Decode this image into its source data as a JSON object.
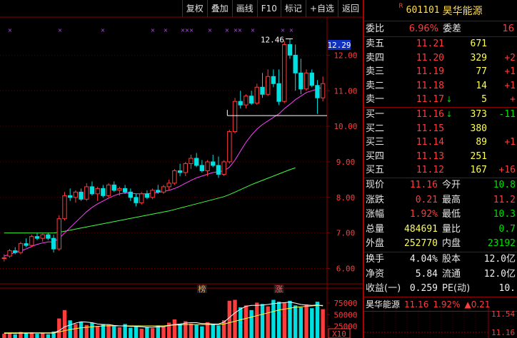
{
  "toolbar": {
    "items": [
      "复权",
      "叠加",
      "画线",
      "F10",
      "标记",
      "+自选",
      "返回"
    ]
  },
  "chart_data": {
    "type": "candlestick",
    "price_axis": {
      "ticks": [
        "12.00",
        "11.00",
        "10.00",
        "9.00",
        "8.00",
        "7.00",
        "6.00"
      ],
      "range": [
        5.65,
        12.75
      ]
    },
    "current_price_label": "12.29",
    "high_annotation": "12.46",
    "volume_axis": {
      "ticks": [
        "75000",
        "50000",
        "25000"
      ],
      "unit_label": "X10",
      "range": [
        0,
        95000
      ]
    },
    "markers": [
      "榜",
      "涨"
    ],
    "candles": [
      [
        6.3,
        6.4,
        6.2,
        6.3
      ],
      [
        6.35,
        6.55,
        6.3,
        6.5
      ],
      [
        6.5,
        6.6,
        6.4,
        6.45
      ],
      [
        6.45,
        6.75,
        6.4,
        6.7
      ],
      [
        6.7,
        6.85,
        6.6,
        6.65
      ],
      [
        6.65,
        6.95,
        6.6,
        6.9
      ],
      [
        6.9,
        7.0,
        6.8,
        6.85
      ],
      [
        6.85,
        7.0,
        6.75,
        6.95
      ],
      [
        6.95,
        7.0,
        6.8,
        6.85
      ],
      [
        6.85,
        6.95,
        6.45,
        6.55
      ],
      [
        6.55,
        7.5,
        6.5,
        7.4
      ],
      [
        7.4,
        8.15,
        7.35,
        8.05
      ],
      [
        8.05,
        8.25,
        7.9,
        8.0
      ],
      [
        8.0,
        8.2,
        7.85,
        8.15
      ],
      [
        8.15,
        8.25,
        7.9,
        7.95
      ],
      [
        7.95,
        8.4,
        7.9,
        8.3
      ],
      [
        8.3,
        8.45,
        8.05,
        8.1
      ],
      [
        8.1,
        8.3,
        7.9,
        8.25
      ],
      [
        8.25,
        8.35,
        8.0,
        8.05
      ],
      [
        8.05,
        8.4,
        8.0,
        8.35
      ],
      [
        8.35,
        8.45,
        8.15,
        8.2
      ],
      [
        8.2,
        8.3,
        8.05,
        8.25
      ],
      [
        8.25,
        8.35,
        8.1,
        8.15
      ],
      [
        8.15,
        8.25,
        7.9,
        8.0
      ],
      [
        8.0,
        8.1,
        7.75,
        7.85
      ],
      [
        7.85,
        8.15,
        7.8,
        8.1
      ],
      [
        8.1,
        8.2,
        7.95,
        8.0
      ],
      [
        8.0,
        8.25,
        7.95,
        8.2
      ],
      [
        8.2,
        8.35,
        8.1,
        8.15
      ],
      [
        8.15,
        8.35,
        8.1,
        8.3
      ],
      [
        8.3,
        8.5,
        8.2,
        8.4
      ],
      [
        8.4,
        8.8,
        8.35,
        8.75
      ],
      [
        8.75,
        8.95,
        8.6,
        8.7
      ],
      [
        8.7,
        9.0,
        8.6,
        8.95
      ],
      [
        8.95,
        9.2,
        8.8,
        9.1
      ],
      [
        9.1,
        9.25,
        8.85,
        8.9
      ],
      [
        8.9,
        9.05,
        8.7,
        8.75
      ],
      [
        8.75,
        9.05,
        8.6,
        9.0
      ],
      [
        9.0,
        9.2,
        8.85,
        8.9
      ],
      [
        8.9,
        9.15,
        8.55,
        8.65
      ],
      [
        8.65,
        9.05,
        8.6,
        9.0
      ],
      [
        9.0,
        9.9,
        8.95,
        9.85
      ],
      [
        9.85,
        10.8,
        9.8,
        10.7
      ],
      [
        10.7,
        11.0,
        10.5,
        10.6
      ],
      [
        10.6,
        10.9,
        10.5,
        10.85
      ],
      [
        10.85,
        11.0,
        10.6,
        10.65
      ],
      [
        10.65,
        11.2,
        10.6,
        11.1
      ],
      [
        11.1,
        11.5,
        10.8,
        10.9
      ],
      [
        10.9,
        11.6,
        10.85,
        11.4
      ],
      [
        11.4,
        11.6,
        11.1,
        11.2
      ],
      [
        11.2,
        11.6,
        10.6,
        10.7
      ],
      [
        10.7,
        12.4,
        10.65,
        12.3
      ],
      [
        12.3,
        12.46,
        11.9,
        12.0
      ],
      [
        12.0,
        12.3,
        11.0,
        11.5
      ],
      [
        11.5,
        11.9,
        10.9,
        11.05
      ],
      [
        11.05,
        11.6,
        11.0,
        11.5
      ],
      [
        11.5,
        11.6,
        11.1,
        11.15
      ],
      [
        11.15,
        11.3,
        10.35,
        10.8
      ],
      [
        10.8,
        11.4,
        10.7,
        11.2
      ]
    ],
    "ma_short": [
      6.35,
      6.4,
      6.45,
      6.5,
      6.55,
      6.62,
      6.68,
      6.72,
      6.75,
      6.75,
      6.85,
      7.0,
      7.15,
      7.3,
      7.45,
      7.6,
      7.72,
      7.82,
      7.9,
      7.98,
      8.05,
      8.1,
      8.12,
      8.12,
      8.1,
      8.1,
      8.1,
      8.12,
      8.14,
      8.17,
      8.2,
      8.25,
      8.32,
      8.4,
      8.48,
      8.55,
      8.6,
      8.65,
      8.7,
      8.72,
      8.75,
      8.85,
      9.05,
      9.3,
      9.55,
      9.75,
      9.92,
      10.05,
      10.15,
      10.25,
      10.35,
      10.5,
      10.62,
      10.75,
      10.85,
      10.95,
      11.0,
      11.05,
      11.1
    ],
    "ma_long": [
      7.0,
      7.0,
      7.0,
      7.0,
      7.0,
      7.0,
      7.0,
      7.0,
      7.0,
      7.0,
      7.02,
      7.05,
      7.08,
      7.11,
      7.14,
      7.17,
      7.2,
      7.23,
      7.26,
      7.29,
      7.32,
      7.35,
      7.38,
      7.41,
      7.44,
      7.47,
      7.5,
      7.53,
      7.56,
      7.59,
      7.62,
      7.66,
      7.7,
      7.74,
      7.78,
      7.82,
      7.86,
      7.9,
      7.94,
      7.98,
      8.02,
      8.08,
      8.15,
      8.22,
      8.29,
      8.36,
      8.42,
      8.48,
      8.54,
      8.6,
      8.66,
      8.72,
      8.78,
      8.83
    ],
    "volumes": [
      9000,
      11000,
      8000,
      13000,
      10000,
      12000,
      9000,
      10000,
      8000,
      14000,
      42000,
      60000,
      38000,
      30000,
      35000,
      28000,
      33000,
      26000,
      30000,
      28000,
      25000,
      23000,
      30000,
      22000,
      26000,
      20000,
      24000,
      21000,
      27000,
      24000,
      33000,
      40000,
      30000,
      36000,
      31000,
      28000,
      25000,
      34000,
      30000,
      27000,
      38000,
      80000,
      82000,
      66000,
      70000,
      60000,
      76000,
      73000,
      68000,
      82000,
      78000,
      76000,
      80000,
      70000,
      66000,
      72000,
      64000,
      78000,
      62000
    ],
    "vol_ma1": [
      10000,
      10200,
      10000,
      10500,
      10400,
      10800,
      10600,
      10700,
      10400,
      10800,
      16000,
      24000,
      28000,
      32000,
      35000,
      34000,
      33000,
      30000,
      29000,
      29000,
      27000,
      26000,
      26000,
      25000,
      25000,
      24000,
      23000,
      23000,
      24000,
      24000,
      27000,
      29000,
      30000,
      32000,
      33000,
      33000,
      31000,
      31000,
      30000,
      30000,
      34000,
      44000,
      54000,
      62000,
      68000,
      70000,
      70000,
      71000,
      72000,
      74000,
      75000,
      76000,
      77000,
      75000,
      72000,
      71000,
      70000,
      71000,
      69000
    ],
    "vol_ma2": [
      11000,
      11000,
      11000,
      11000,
      11000,
      11000,
      11000,
      11000,
      11000,
      11000,
      13000,
      16000,
      18000,
      20000,
      22000,
      23000,
      24000,
      25000,
      26000,
      26000,
      26000,
      26000,
      26000,
      26000,
      26000,
      26000,
      26000,
      26000,
      26000,
      26000,
      27000,
      28000,
      28000,
      29000,
      29000,
      29000,
      29000,
      29000,
      29000,
      29000,
      30000,
      33000,
      36000,
      39000,
      42000,
      45000,
      48000,
      51000,
      54000,
      57000,
      60000,
      62000,
      64000,
      66000,
      67000,
      68000,
      69000,
      70000,
      70000
    ]
  },
  "stock": {
    "mark": "R",
    "code": "601101",
    "name": "昊华能源"
  },
  "weibi": {
    "label1": "委比",
    "value1": "6.96%",
    "label2": "委差",
    "value2": "16"
  },
  "sell_orders": [
    {
      "label": "卖五",
      "price": "11.21",
      "vol": "671",
      "chg": ""
    },
    {
      "label": "卖四",
      "price": "11.20",
      "vol": "329",
      "chg": "+2"
    },
    {
      "label": "卖三",
      "price": "11.19",
      "vol": "77",
      "chg": "+1"
    },
    {
      "label": "卖二",
      "price": "11.18",
      "vol": "14",
      "chg": "+1"
    },
    {
      "label": "卖一",
      "price": "11.17",
      "arrow": "↓",
      "vol": "5",
      "chg": "+"
    }
  ],
  "buy_orders": [
    {
      "label": "买一",
      "price": "11.16",
      "arrow": "↓",
      "vol": "373",
      "chg": "-11"
    },
    {
      "label": "买二",
      "price": "11.15",
      "vol": "380",
      "chg": ""
    },
    {
      "label": "买三",
      "price": "11.14",
      "vol": "89",
      "chg": "+1"
    },
    {
      "label": "买四",
      "price": "11.13",
      "vol": "251",
      "chg": ""
    },
    {
      "label": "买五",
      "price": "11.12",
      "vol": "167",
      "chg": "+16"
    }
  ],
  "quotes": [
    {
      "l1": "现价",
      "v1": "11.16",
      "l2": "今开",
      "v2": "10.8"
    },
    {
      "l1": "涨跌",
      "v1": "0.21",
      "l2": "最高",
      "v2": "11.2"
    },
    {
      "l1": "涨幅",
      "v1": "1.92%",
      "l2": "最低",
      "v2": "10.3"
    },
    {
      "l1": "总量",
      "v1": "484691",
      "l2": "量比",
      "v2": "0.7"
    },
    {
      "l1": "外盘",
      "v1": "252770",
      "l2": "内盘",
      "v2": "23192"
    }
  ],
  "extra": [
    {
      "l1": "换手",
      "v1": "4.04%",
      "l2": "股本",
      "v2": "12.0亿"
    },
    {
      "l1": "净资",
      "v1": "5.84",
      "l2": "流通",
      "v2": "12.0亿"
    },
    {
      "l1": "收益(一)",
      "v1": "0.259",
      "l2": "PE(动)",
      "v2": "10."
    }
  ],
  "mini": {
    "name": "昊华能源",
    "price": "11.16",
    "pct": "1.92%",
    "chg": "▲0.21",
    "ticks": [
      "11.54",
      "11.16"
    ]
  },
  "colors": {
    "up": "#ff3c3c",
    "down": "#00e0e0",
    "ma_short": "#ff40ff",
    "ma_long": "#40ff40",
    "vol_ma1": "#ffffff",
    "vol_ma2": "#ffff40",
    "grid": "#8b0000"
  }
}
